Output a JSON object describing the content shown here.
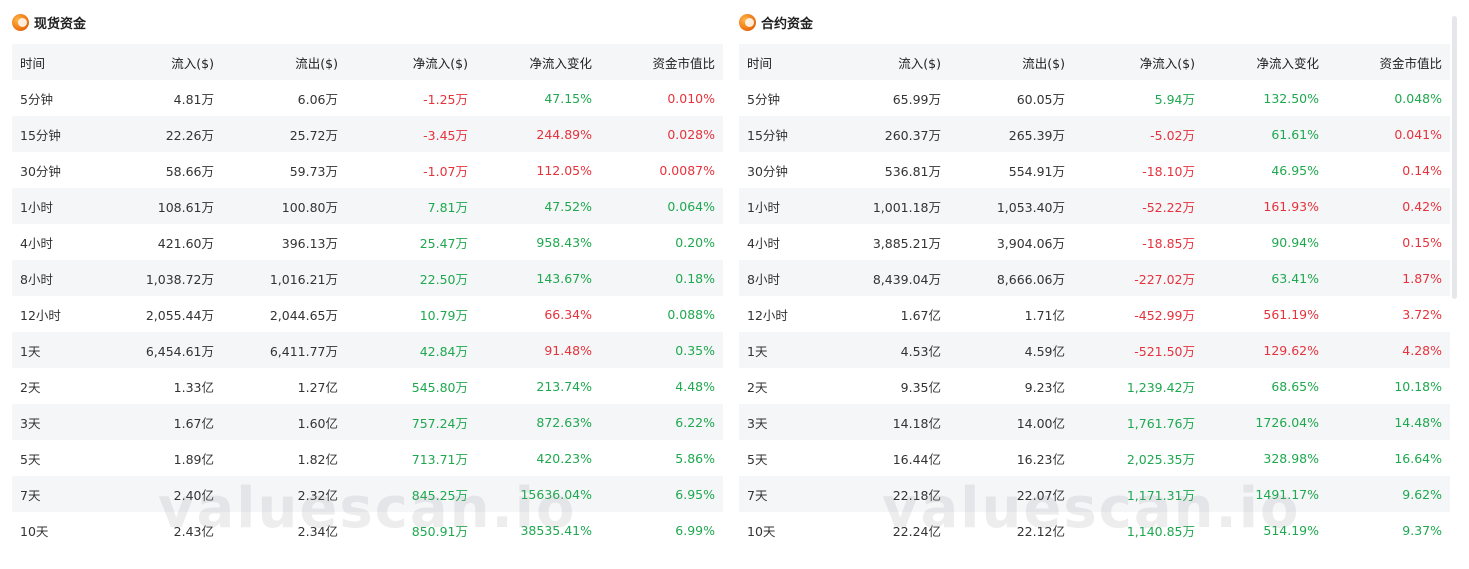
{
  "spot": {
    "title": "现货资金",
    "headers": [
      "时间",
      "流入($)",
      "流出($)",
      "净流入($)",
      "净流入变化",
      "资金市值比"
    ],
    "rows": [
      {
        "time": "5分钟",
        "inflow": "4.81万",
        "outflow": "6.06万",
        "net": "-1.25万",
        "net_sign": "neg",
        "change": "47.15%",
        "change_sign": "pos",
        "ratio": "0.010%",
        "ratio_sign": "neg"
      },
      {
        "time": "15分钟",
        "inflow": "22.26万",
        "outflow": "25.72万",
        "net": "-3.45万",
        "net_sign": "neg",
        "change": "244.89%",
        "change_sign": "neg",
        "ratio": "0.028%",
        "ratio_sign": "neg"
      },
      {
        "time": "30分钟",
        "inflow": "58.66万",
        "outflow": "59.73万",
        "net": "-1.07万",
        "net_sign": "neg",
        "change": "112.05%",
        "change_sign": "neg",
        "ratio": "0.0087%",
        "ratio_sign": "neg"
      },
      {
        "time": "1小时",
        "inflow": "108.61万",
        "outflow": "100.80万",
        "net": "7.81万",
        "net_sign": "pos",
        "change": "47.52%",
        "change_sign": "pos",
        "ratio": "0.064%",
        "ratio_sign": "pos"
      },
      {
        "time": "4小时",
        "inflow": "421.60万",
        "outflow": "396.13万",
        "net": "25.47万",
        "net_sign": "pos",
        "change": "958.43%",
        "change_sign": "pos",
        "ratio": "0.20%",
        "ratio_sign": "pos"
      },
      {
        "time": "8小时",
        "inflow": "1,038.72万",
        "outflow": "1,016.21万",
        "net": "22.50万",
        "net_sign": "pos",
        "change": "143.67%",
        "change_sign": "pos",
        "ratio": "0.18%",
        "ratio_sign": "pos"
      },
      {
        "time": "12小时",
        "inflow": "2,055.44万",
        "outflow": "2,044.65万",
        "net": "10.79万",
        "net_sign": "pos",
        "change": "66.34%",
        "change_sign": "neg",
        "ratio": "0.088%",
        "ratio_sign": "pos"
      },
      {
        "time": "1天",
        "inflow": "6,454.61万",
        "outflow": "6,411.77万",
        "net": "42.84万",
        "net_sign": "pos",
        "change": "91.48%",
        "change_sign": "neg",
        "ratio": "0.35%",
        "ratio_sign": "pos"
      },
      {
        "time": "2天",
        "inflow": "1.33亿",
        "outflow": "1.27亿",
        "net": "545.80万",
        "net_sign": "pos",
        "change": "213.74%",
        "change_sign": "pos",
        "ratio": "4.48%",
        "ratio_sign": "pos"
      },
      {
        "time": "3天",
        "inflow": "1.67亿",
        "outflow": "1.60亿",
        "net": "757.24万",
        "net_sign": "pos",
        "change": "872.63%",
        "change_sign": "pos",
        "ratio": "6.22%",
        "ratio_sign": "pos"
      },
      {
        "time": "5天",
        "inflow": "1.89亿",
        "outflow": "1.82亿",
        "net": "713.71万",
        "net_sign": "pos",
        "change": "420.23%",
        "change_sign": "pos",
        "ratio": "5.86%",
        "ratio_sign": "pos"
      },
      {
        "time": "7天",
        "inflow": "2.40亿",
        "outflow": "2.32亿",
        "net": "845.25万",
        "net_sign": "pos",
        "change": "15636.04%",
        "change_sign": "pos",
        "ratio": "6.95%",
        "ratio_sign": "pos"
      },
      {
        "time": "10天",
        "inflow": "2.43亿",
        "outflow": "2.34亿",
        "net": "850.91万",
        "net_sign": "pos",
        "change": "38535.41%",
        "change_sign": "pos",
        "ratio": "6.99%",
        "ratio_sign": "pos"
      }
    ]
  },
  "contract": {
    "title": "合约资金",
    "headers": [
      "时间",
      "流入($)",
      "流出($)",
      "净流入($)",
      "净流入变化",
      "资金市值比"
    ],
    "rows": [
      {
        "time": "5分钟",
        "inflow": "65.99万",
        "outflow": "60.05万",
        "net": "5.94万",
        "net_sign": "pos",
        "change": "132.50%",
        "change_sign": "pos",
        "ratio": "0.048%",
        "ratio_sign": "pos"
      },
      {
        "time": "15分钟",
        "inflow": "260.37万",
        "outflow": "265.39万",
        "net": "-5.02万",
        "net_sign": "neg",
        "change": "61.61%",
        "change_sign": "pos",
        "ratio": "0.041%",
        "ratio_sign": "neg"
      },
      {
        "time": "30分钟",
        "inflow": "536.81万",
        "outflow": "554.91万",
        "net": "-18.10万",
        "net_sign": "neg",
        "change": "46.95%",
        "change_sign": "pos",
        "ratio": "0.14%",
        "ratio_sign": "neg"
      },
      {
        "time": "1小时",
        "inflow": "1,001.18万",
        "outflow": "1,053.40万",
        "net": "-52.22万",
        "net_sign": "neg",
        "change": "161.93%",
        "change_sign": "neg",
        "ratio": "0.42%",
        "ratio_sign": "neg"
      },
      {
        "time": "4小时",
        "inflow": "3,885.21万",
        "outflow": "3,904.06万",
        "net": "-18.85万",
        "net_sign": "neg",
        "change": "90.94%",
        "change_sign": "pos",
        "ratio": "0.15%",
        "ratio_sign": "neg"
      },
      {
        "time": "8小时",
        "inflow": "8,439.04万",
        "outflow": "8,666.06万",
        "net": "-227.02万",
        "net_sign": "neg",
        "change": "63.41%",
        "change_sign": "pos",
        "ratio": "1.87%",
        "ratio_sign": "neg"
      },
      {
        "time": "12小时",
        "inflow": "1.67亿",
        "outflow": "1.71亿",
        "net": "-452.99万",
        "net_sign": "neg",
        "change": "561.19%",
        "change_sign": "neg",
        "ratio": "3.72%",
        "ratio_sign": "neg"
      },
      {
        "time": "1天",
        "inflow": "4.53亿",
        "outflow": "4.59亿",
        "net": "-521.50万",
        "net_sign": "neg",
        "change": "129.62%",
        "change_sign": "neg",
        "ratio": "4.28%",
        "ratio_sign": "neg"
      },
      {
        "time": "2天",
        "inflow": "9.35亿",
        "outflow": "9.23亿",
        "net": "1,239.42万",
        "net_sign": "pos",
        "change": "68.65%",
        "change_sign": "pos",
        "ratio": "10.18%",
        "ratio_sign": "pos"
      },
      {
        "time": "3天",
        "inflow": "14.18亿",
        "outflow": "14.00亿",
        "net": "1,761.76万",
        "net_sign": "pos",
        "change": "1726.04%",
        "change_sign": "pos",
        "ratio": "14.48%",
        "ratio_sign": "pos"
      },
      {
        "time": "5天",
        "inflow": "16.44亿",
        "outflow": "16.23亿",
        "net": "2,025.35万",
        "net_sign": "pos",
        "change": "328.98%",
        "change_sign": "pos",
        "ratio": "16.64%",
        "ratio_sign": "pos"
      },
      {
        "time": "7天",
        "inflow": "22.18亿",
        "outflow": "22.07亿",
        "net": "1,171.31万",
        "net_sign": "pos",
        "change": "1491.17%",
        "change_sign": "pos",
        "ratio": "9.62%",
        "ratio_sign": "pos"
      },
      {
        "time": "10天",
        "inflow": "22.24亿",
        "outflow": "22.12亿",
        "net": "1,140.85万",
        "net_sign": "pos",
        "change": "514.19%",
        "change_sign": "pos",
        "ratio": "9.37%",
        "ratio_sign": "pos"
      }
    ]
  },
  "watermark": "valuescan.io",
  "colors": {
    "positive": "#1fa84f",
    "negative": "#e5333d",
    "row_shade": "#f5f6f8",
    "logo": "#f07b16"
  },
  "icons": {
    "logo": "valuescan-logo-icon"
  }
}
